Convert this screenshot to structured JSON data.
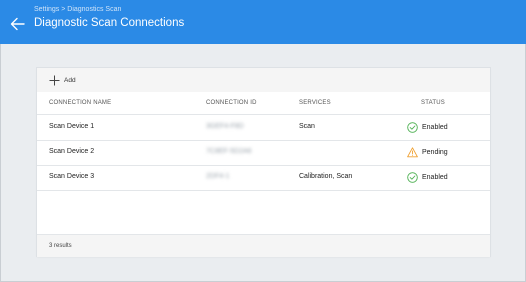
{
  "header": {
    "breadcrumb": "Settings > Diagnostics Scan",
    "title": "Diagnostic Scan Connections",
    "back_icon": "arrow-left-icon",
    "background": "#2b8ae6"
  },
  "toolbar": {
    "add_label": "Add",
    "add_icon": "plus-icon"
  },
  "table": {
    "columns": [
      "CONNECTION NAME",
      "CONNECTION ID",
      "SERVICES",
      "STATUS"
    ],
    "rows": [
      {
        "name": "Scan Device 1",
        "connection_id": "3GEF4-F8D",
        "services": "Scan",
        "status": "Enabled",
        "status_icon": "check-circle-icon"
      },
      {
        "name": "Scan Device 2",
        "connection_id": "7C8EF-5D2A6",
        "services": "",
        "status": "Pending",
        "status_icon": "warning-triangle-icon"
      },
      {
        "name": "Scan Device 3",
        "connection_id": "2DF4-1",
        "services": "Calibration, Scan",
        "status": "Enabled",
        "status_icon": "check-circle-icon"
      }
    ]
  },
  "footer": {
    "results": "3 results"
  },
  "colors": {
    "enabled": "#4caf50",
    "pending": "#f0a030",
    "header": "#2b8ae6"
  }
}
